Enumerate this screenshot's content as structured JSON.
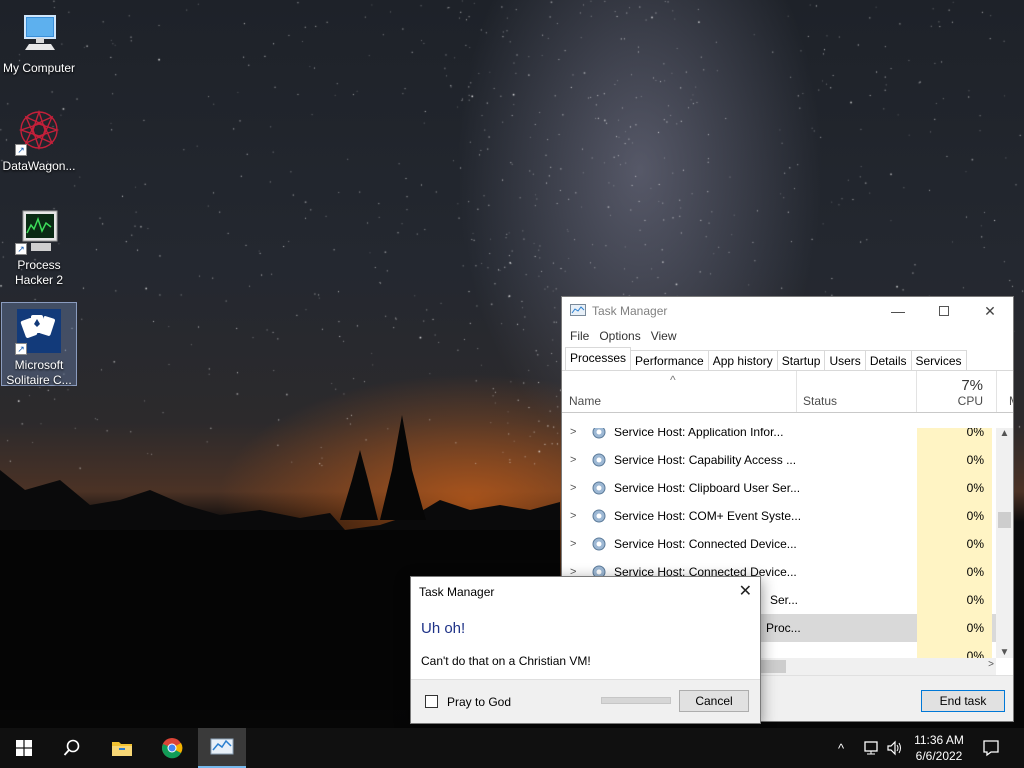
{
  "desktop": {
    "icons": [
      {
        "label": "My Computer",
        "icon": "computer-icon"
      },
      {
        "label": "DataWagon...",
        "icon": "datawagon-icon"
      },
      {
        "label": "Process Hacker 2",
        "icon": "process-hacker-icon"
      },
      {
        "label": "Microsoft Solitaire C...",
        "icon": "solitaire-icon"
      }
    ]
  },
  "task_manager": {
    "title": "Task Manager",
    "menu": [
      "File",
      "Options",
      "View"
    ],
    "tabs": [
      "Processes",
      "Performance",
      "App history",
      "Startup",
      "Users",
      "Details",
      "Services"
    ],
    "active_tab": "Processes",
    "columns": {
      "name": "Name",
      "status": "Status",
      "cpu_total": "7%",
      "cpu": "CPU"
    },
    "rows": [
      {
        "name": "Service Host: Application Infor...",
        "cpu": "0%"
      },
      {
        "name": "Service Host: Capability Access ...",
        "cpu": "0%"
      },
      {
        "name": "Service Host: Clipboard User Ser...",
        "cpu": "0%"
      },
      {
        "name": "Service Host: COM+ Event Syste...",
        "cpu": "0%"
      },
      {
        "name": "Service Host: Connected Device...",
        "cpu": "0%"
      },
      {
        "name": "Service Host: Connected Device...",
        "cpu": "0%"
      },
      {
        "name": "Ser...",
        "cpu": "0%"
      },
      {
        "name": "Proc...",
        "cpu": "0%"
      },
      {
        "name": "",
        "cpu": "0%"
      }
    ],
    "end_task_label": "End task"
  },
  "dialog": {
    "title": "Task Manager",
    "heading": "Uh oh!",
    "message": "Can't do that on a Christian VM!",
    "checkbox_label": "Pray to God",
    "cancel_label": "Cancel"
  },
  "taskbar": {
    "apps": [
      "start-icon",
      "search-icon",
      "file-explorer-icon",
      "chrome-icon",
      "task-manager-icon"
    ],
    "time": "11:36 AM",
    "date": "6/6/2022"
  }
}
